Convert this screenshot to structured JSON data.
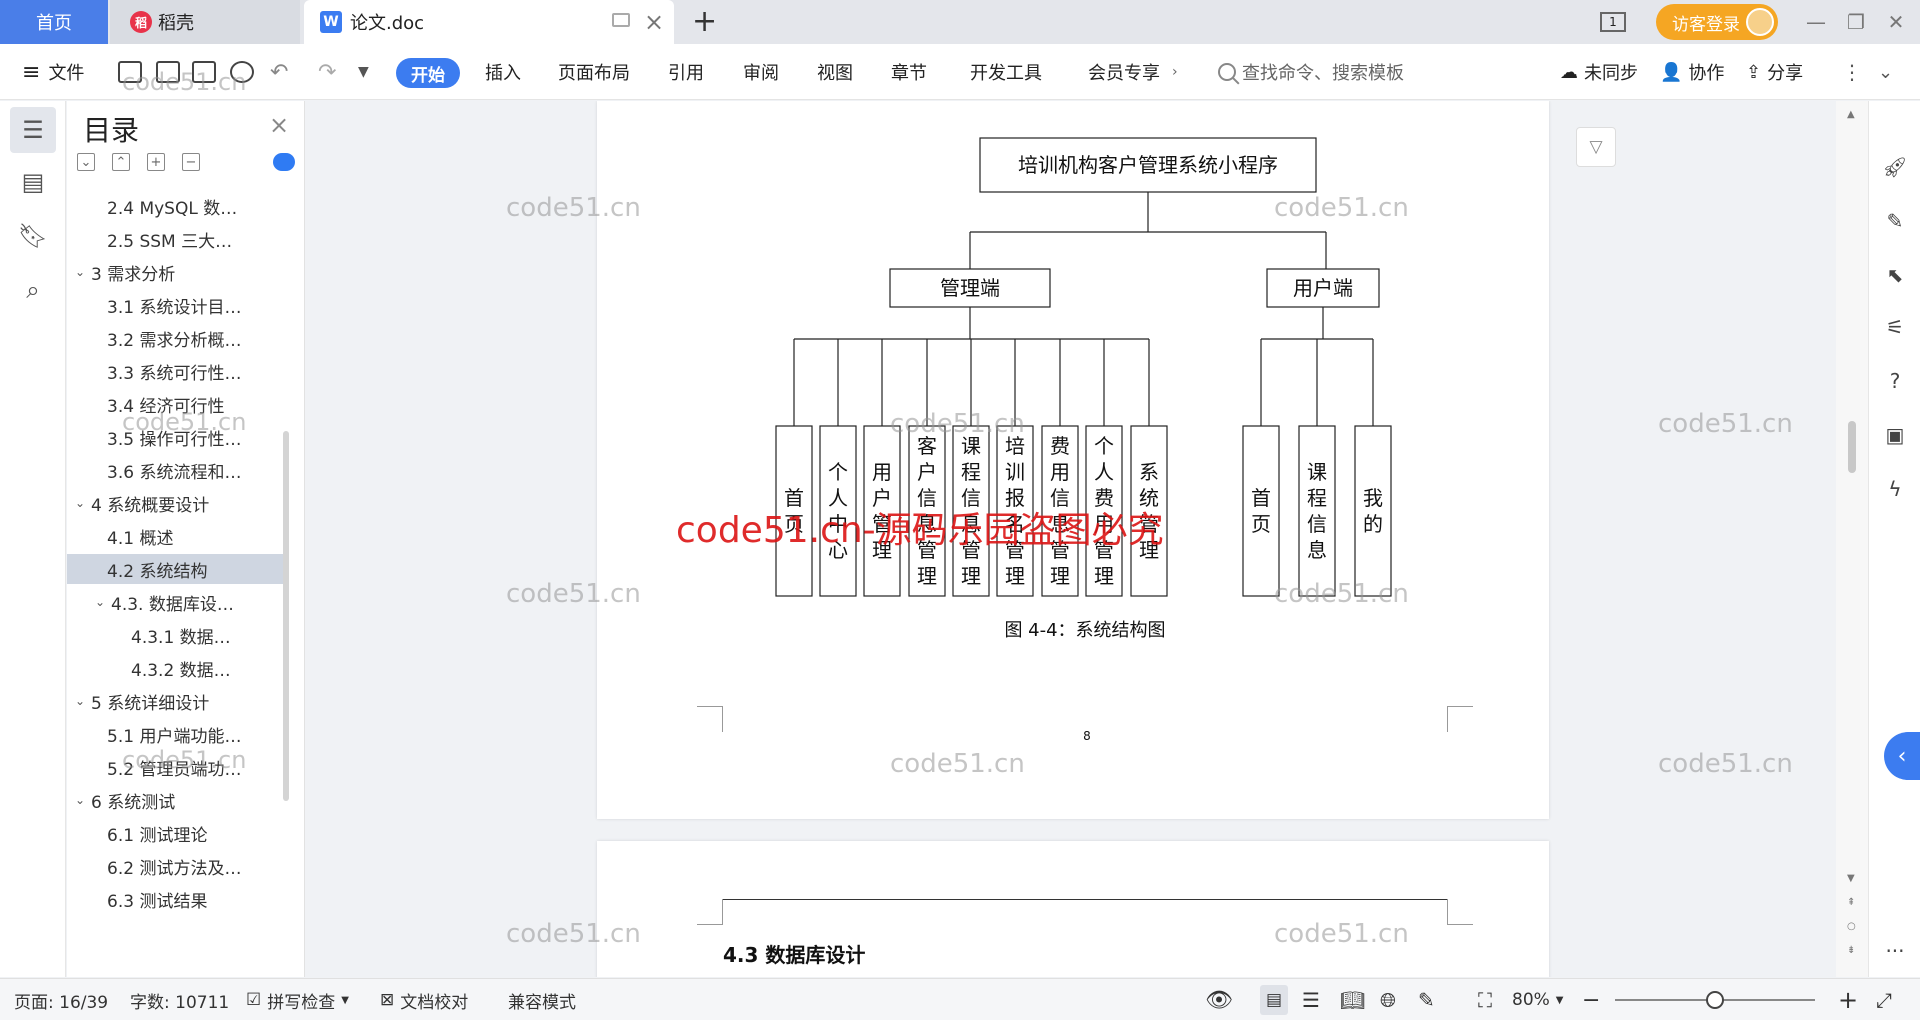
{
  "tabs": {
    "home": "首页",
    "docer": "稻壳",
    "document": "论文.doc",
    "login": "访客登录",
    "page_indicator": "1"
  },
  "ribbon": {
    "file": "文件",
    "start": "开始",
    "menus": [
      "插入",
      "页面布局",
      "引用",
      "审阅",
      "视图",
      "章节",
      "开发工具",
      "会员专享"
    ],
    "search_placeholder": "查找命令、搜索模板",
    "sync": "未同步",
    "collab": "协作",
    "share": "分享"
  },
  "toc": {
    "title": "目录",
    "items": [
      {
        "label": "2.4 MySQL 数…",
        "level": 2
      },
      {
        "label": "2.5 SSM 三大…",
        "level": 2
      },
      {
        "label": "3  需求分析",
        "level": 1
      },
      {
        "label": "3.1  系统设计目…",
        "level": 2
      },
      {
        "label": "3.2 需求分析概…",
        "level": 2
      },
      {
        "label": "3.3  系统可行性…",
        "level": 2
      },
      {
        "label": "3.4 经济可行性",
        "level": 2
      },
      {
        "label": "3.5 操作可行性…",
        "level": 2
      },
      {
        "label": "3.6 系统流程和…",
        "level": 2
      },
      {
        "label": "4 系统概要设计",
        "level": 1
      },
      {
        "label": "4.1  概述",
        "level": 2
      },
      {
        "label": "4.2  系统结构",
        "level": 2,
        "selected": true
      },
      {
        "label": "4.3.  数据库设…",
        "level": 2,
        "expandable": true
      },
      {
        "label": "4.3.1  数据…",
        "level": 3
      },
      {
        "label": "4.3.2  数据…",
        "level": 3
      },
      {
        "label": "5 系统详细设计",
        "level": 1
      },
      {
        "label": "5.1 用户端功能…",
        "level": 2
      },
      {
        "label": "5.2 管理员端功…",
        "level": 2
      },
      {
        "label": "6  系统测试",
        "level": 1
      },
      {
        "label": "6.1  测试理论",
        "level": 2
      },
      {
        "label": "6.2  测试方法及…",
        "level": 2
      },
      {
        "label": "6.3 测试结果",
        "level": 2
      }
    ]
  },
  "diagram": {
    "root": "培训机构客户管理系统小程序",
    "admin": {
      "label": "管理端",
      "children": [
        "首页",
        "个人中心",
        "用户管理",
        "客户信息管理",
        "课程信息管理",
        "培训报名管理",
        "费用信息管理",
        "个人费用管理",
        "系统管理"
      ]
    },
    "user": {
      "label": "用户端",
      "children": [
        "首页",
        "课程信息",
        "我的"
      ]
    },
    "caption": "图 4-4：系统结构图",
    "page_number": "8"
  },
  "next_page_heading": "4.3  数据库设计",
  "watermarks": {
    "gray": "code51.cn",
    "red": "code51.cn-源码乐园盗图必究"
  },
  "status": {
    "page": "页面: 16/39",
    "words": "字数: 10711",
    "spell": "拼写检查",
    "proof": "文档校对",
    "compat": "兼容模式",
    "zoom": "80%",
    "zoom_level": 0.5
  }
}
